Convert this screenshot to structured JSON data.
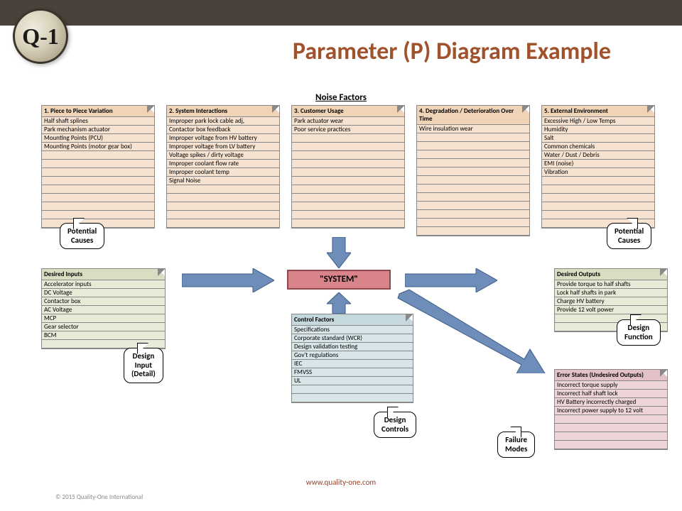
{
  "logo": "Q-1",
  "title": "Parameter (P) Diagram Example",
  "noise_header": "Noise Factors",
  "system_label": "\"SYSTEM\"",
  "noise_boxes": [
    {
      "title": "1. Piece to Piece Variation",
      "items": [
        "Half shaft splines",
        "Park mechanism actuator",
        "Mounting Points (PCU)",
        "Mounting Points (motor gear box)"
      ]
    },
    {
      "title": "2. System Interactions",
      "items": [
        "Improper park lock cable adj,",
        "Contactor box feedback",
        "Improper voltage from HV battery",
        "Improper voltage from LV battery",
        "Voltage spikes / dirty voltage",
        "Improper coolant flow rate",
        "Improper coolant temp",
        "Signal Noise"
      ]
    },
    {
      "title": "3. Customer Usage",
      "items": [
        "Park actuator wear",
        "Poor service practices"
      ]
    },
    {
      "title": "4. Degradation / Deterioration Over Time",
      "items": [
        "Wire insulation wear"
      ]
    },
    {
      "title": "5. External Environment",
      "items": [
        "Excessive High / Low Temps",
        "Humidity",
        "Salt",
        "Common chemicals",
        "Water / Dust / Debris",
        "EMI (noise)",
        "Vibration"
      ]
    }
  ],
  "inputs": {
    "title": "Desired Inputs",
    "items": [
      "Accelerator inputs",
      "DC Voltage",
      "Contactor box",
      "AC Voltage",
      "MCP",
      "Gear selector",
      "BCM"
    ]
  },
  "outputs": {
    "title": "Desired Outputs",
    "items": [
      "Provide torque to half shafts",
      "Lock half shafts in park",
      "Charge HV battery",
      "Provide 12 volt power"
    ]
  },
  "control": {
    "title": "Control Factors",
    "items": [
      "Specifications",
      "Corporate standard (WCR)",
      "Design validation testing",
      "Gov't regulations",
      "IEC",
      "FMVSS",
      "UL"
    ]
  },
  "error": {
    "title": "Error States (Undesired Outputs)",
    "items": [
      "Incorrect torque supply",
      "Incorrect half shaft lock",
      "HV Battery incorrectly charged",
      "Incorrect power supply to 12 volt"
    ]
  },
  "callouts": {
    "pc_left": "Potential\nCauses",
    "pc_right": "Potential\nCauses",
    "design_input": "Design\nInput\n(Detail)",
    "design_function": "Design\nFunction",
    "design_controls": "Design\nControls",
    "failure_modes": "Failure\nModes"
  },
  "footer_url": "www.quality-one.com",
  "copyright": "© 2015 Quality-One International"
}
